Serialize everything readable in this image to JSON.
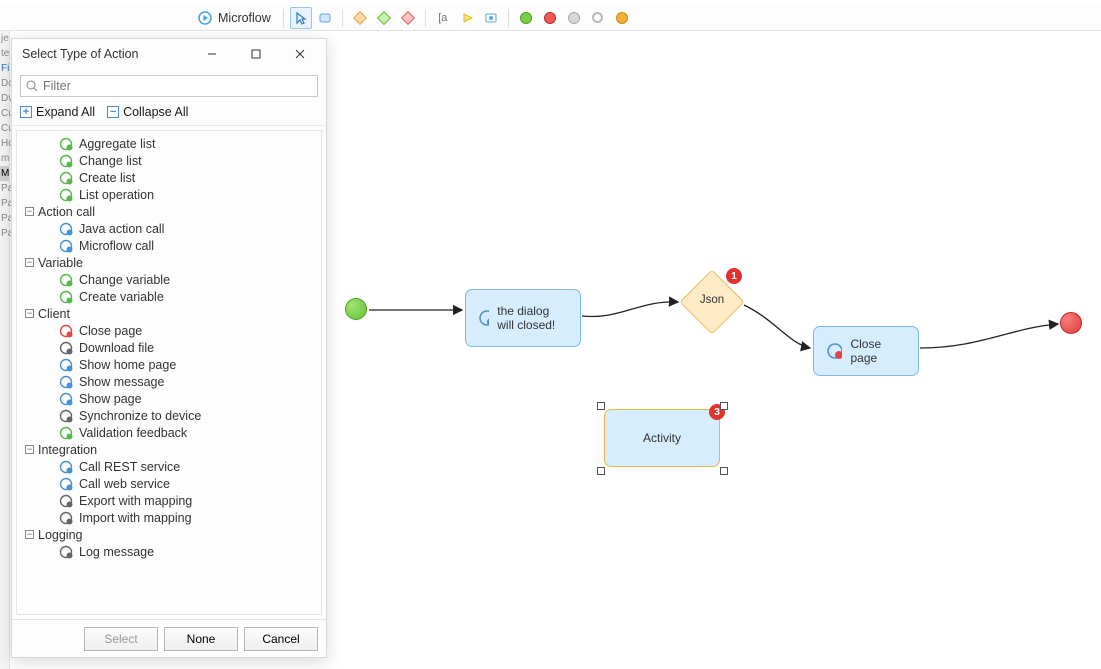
{
  "toolbar": {
    "title": "Microflow"
  },
  "dialog": {
    "title": "Select Type of Action",
    "filter_placeholder": "Filter",
    "expand_all": "Expand All",
    "collapse_all": "Collapse All",
    "buttons": {
      "select": "Select",
      "none": "None",
      "cancel": "Cancel"
    }
  },
  "leftbar": [
    "je",
    "te",
    "Fi",
    "Dc",
    "Dv",
    "Cu",
    "Cu",
    "Hc",
    "m",
    "M",
    "Pa",
    "Pa",
    "Pa",
    "Pa"
  ],
  "tree": [
    {
      "group": null,
      "items": [
        "Aggregate list",
        "Change list",
        "Create list",
        "List operation"
      ]
    },
    {
      "group": "Action call",
      "items": [
        "Java action call",
        "Microflow call"
      ]
    },
    {
      "group": "Variable",
      "items": [
        "Change variable",
        "Create variable"
      ]
    },
    {
      "group": "Client",
      "items": [
        "Close page",
        "Download file",
        "Show home page",
        "Show message",
        "Show page",
        "Synchronize to device",
        "Validation feedback"
      ]
    },
    {
      "group": "Integration",
      "items": [
        "Call REST service",
        "Call web service",
        "Export with mapping",
        "Import with mapping"
      ]
    },
    {
      "group": "Logging",
      "items": [
        "Log message"
      ]
    }
  ],
  "canvas": {
    "activity1": "the dialog will closed!",
    "decision1": "Json",
    "badge1": "1",
    "activity2": "Close page",
    "activity3": "Activity",
    "badge3": "3"
  }
}
